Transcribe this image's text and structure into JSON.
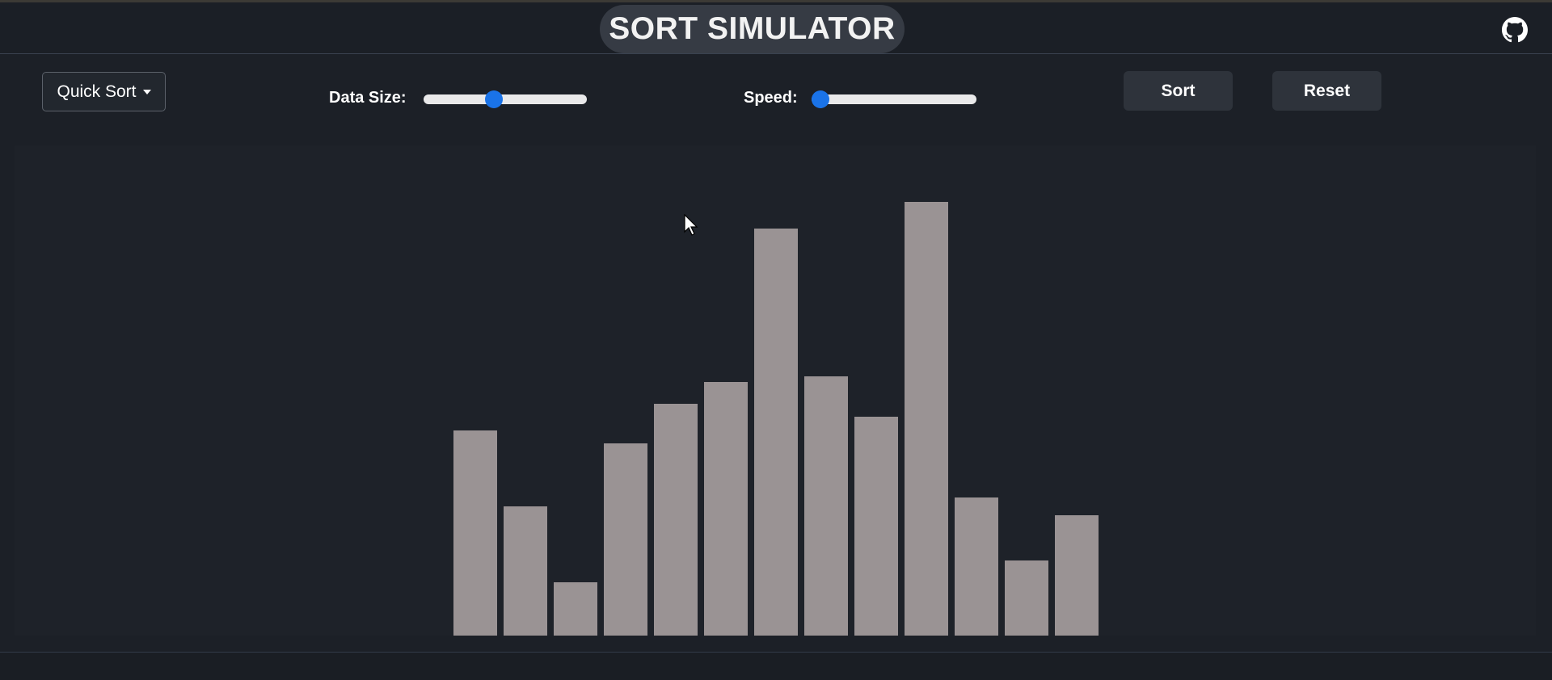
{
  "header": {
    "title": "SORT SIMULATOR",
    "github_icon": "github-icon"
  },
  "controls": {
    "algorithm": "Quick Sort",
    "data_size_label": "Data Size:",
    "data_size_level": 0.42,
    "speed_label": "Speed:",
    "speed_level": 0.0,
    "sort_label": "Sort",
    "reset_label": "Reset"
  },
  "colors": {
    "background": "#1c2027",
    "bar": "#9a9394",
    "slider_knob": "#1a73e8",
    "button": "#2e333b"
  },
  "chart_data": {
    "type": "bar",
    "values": [
      248,
      156,
      64,
      232,
      280,
      306,
      492,
      313,
      264,
      524,
      167,
      91,
      145
    ],
    "ylim": [
      0,
      600
    ]
  }
}
